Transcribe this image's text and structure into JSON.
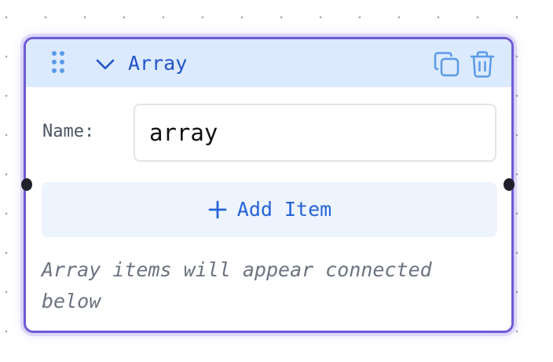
{
  "node": {
    "title": "Array",
    "name_label": "Name:",
    "name_value": "array",
    "add_item_label": "Add Item",
    "hint_text": "Array items will appear connected below",
    "icons": {
      "drag": "drag-handle-icon",
      "collapse": "chevron-down-icon",
      "duplicate": "copy-icon",
      "delete": "trash-icon",
      "add": "plus-icon"
    }
  },
  "colors": {
    "node_border": "#6e5bd8",
    "header_background": "#dbeafe",
    "accent_text": "#2353c9",
    "icon_blue": "#5b9ae8",
    "add_button_background": "#eef4fe",
    "hint_text": "#6b7280",
    "connection_handle": "#1f2029"
  }
}
